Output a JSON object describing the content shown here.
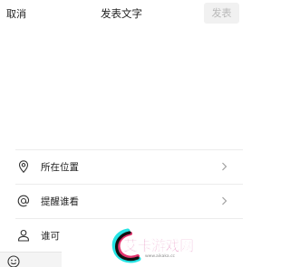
{
  "nav": {
    "cancel_label": "取消",
    "title": "发表文字",
    "publish_label": "发表"
  },
  "compose": {
    "text": ""
  },
  "options": [
    {
      "label": "所在位置",
      "icon": "location-pin-icon"
    },
    {
      "label": "提醒谁看",
      "icon": "at-sign-icon"
    },
    {
      "label": "谁可",
      "icon": "person-icon"
    }
  ],
  "toolbar": {
    "emoji_icon": "emoji-icon"
  },
  "watermark": {
    "brand": "艾卡游戏网",
    "url": "www.aikaka.cc"
  },
  "colors": {
    "publish_disabled_bg": "#f1f1f1",
    "publish_disabled_text": "#b9b9b9",
    "divider": "#ececec",
    "watermark_accent": "#d23d8f"
  }
}
